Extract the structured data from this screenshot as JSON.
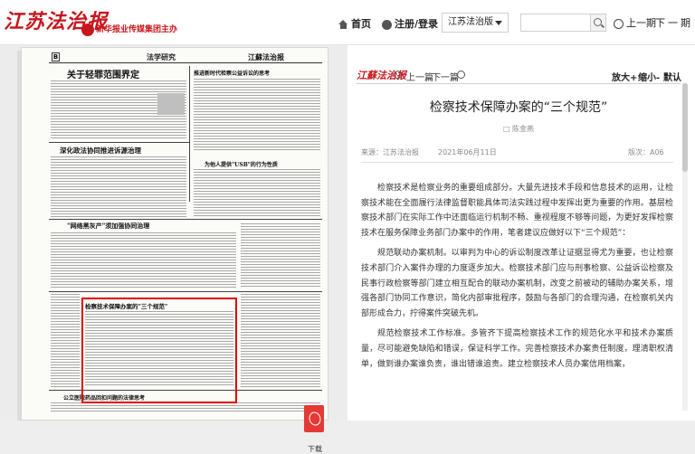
{
  "header": {
    "logo": "江苏法治报",
    "logo_sub": "新华报业传媒集团主办",
    "nav_home": "首页",
    "nav_login": "注册/登录",
    "edition_select": "江苏法治版",
    "search_placeholder": "",
    "prev_page": "上一期",
    "next_page": "下一期"
  },
  "newspaper": {
    "page_no": "B",
    "section": "法学研究",
    "masthead": "江蘇法治报",
    "headlines": [
      "关于轻罪范围界定",
      "推进新时代检察公益诉讼的思考",
      "深化政法协同推进诉源治理",
      "为他人提供\"USB\"的行为性质",
      "\"网络黑灰产\"须加强协同治理",
      "检察技术保障办案的\"三个规范\"",
      "公立医院药品回扣问题的法律思考"
    ],
    "pdf_label": "下载"
  },
  "article": {
    "masthead": "江蘇法治报",
    "prev": "上一篇",
    "next": "下一篇",
    "zoom_in": "放大+",
    "zoom_out": "缩小-",
    "zoom_default": "默认",
    "title": "检察技术保障办案的“三个规范”",
    "author": "□ 陈金燕",
    "source": "来源：江苏法治报",
    "date": "2021年06月11日",
    "page": "版次：A06",
    "paragraphs": [
      "检察技术是检察业务的重要组成部分。大量先进技术手段和信息技术的运用，让检察技术能在全面履行法律监督职能具体司法实践过程中发挥出更为重要的作用。基层检察技术部门在实际工作中还面临运行机制不畅、重视程度不够等问题，为更好发挥检察技术在服务保障业务部门办案中的作用，笔者建议应做好以下“三个规范”：",
      "规范联动办案机制。以审判为中心的诉讼制度改革让证据显得尤为重要，也让检察技术部门介入案件办理的力度逐步加大。检察技术部门应与刑事检察、公益诉讼检察及民事行政检察等部门建立相互配合的联动办案机制，改变之前被动的辅助办案关系，增强各部门协同工作意识，简化内部审批程序，鼓励与各部门的合理沟通，在检察机关内部形成合力，拧得案件突破先机。",
      "规范检察技术工作标准。多管齐下提高检察技术工作的规范化水平和技术办案质量，尽可能避免缺陷和错误，保证科学工作。完善检察技术办案责任制度，理清职权清单，做到谁办案谁负责，谁出错谁追责。建立检察技术人员办案信用档案，"
    ]
  }
}
